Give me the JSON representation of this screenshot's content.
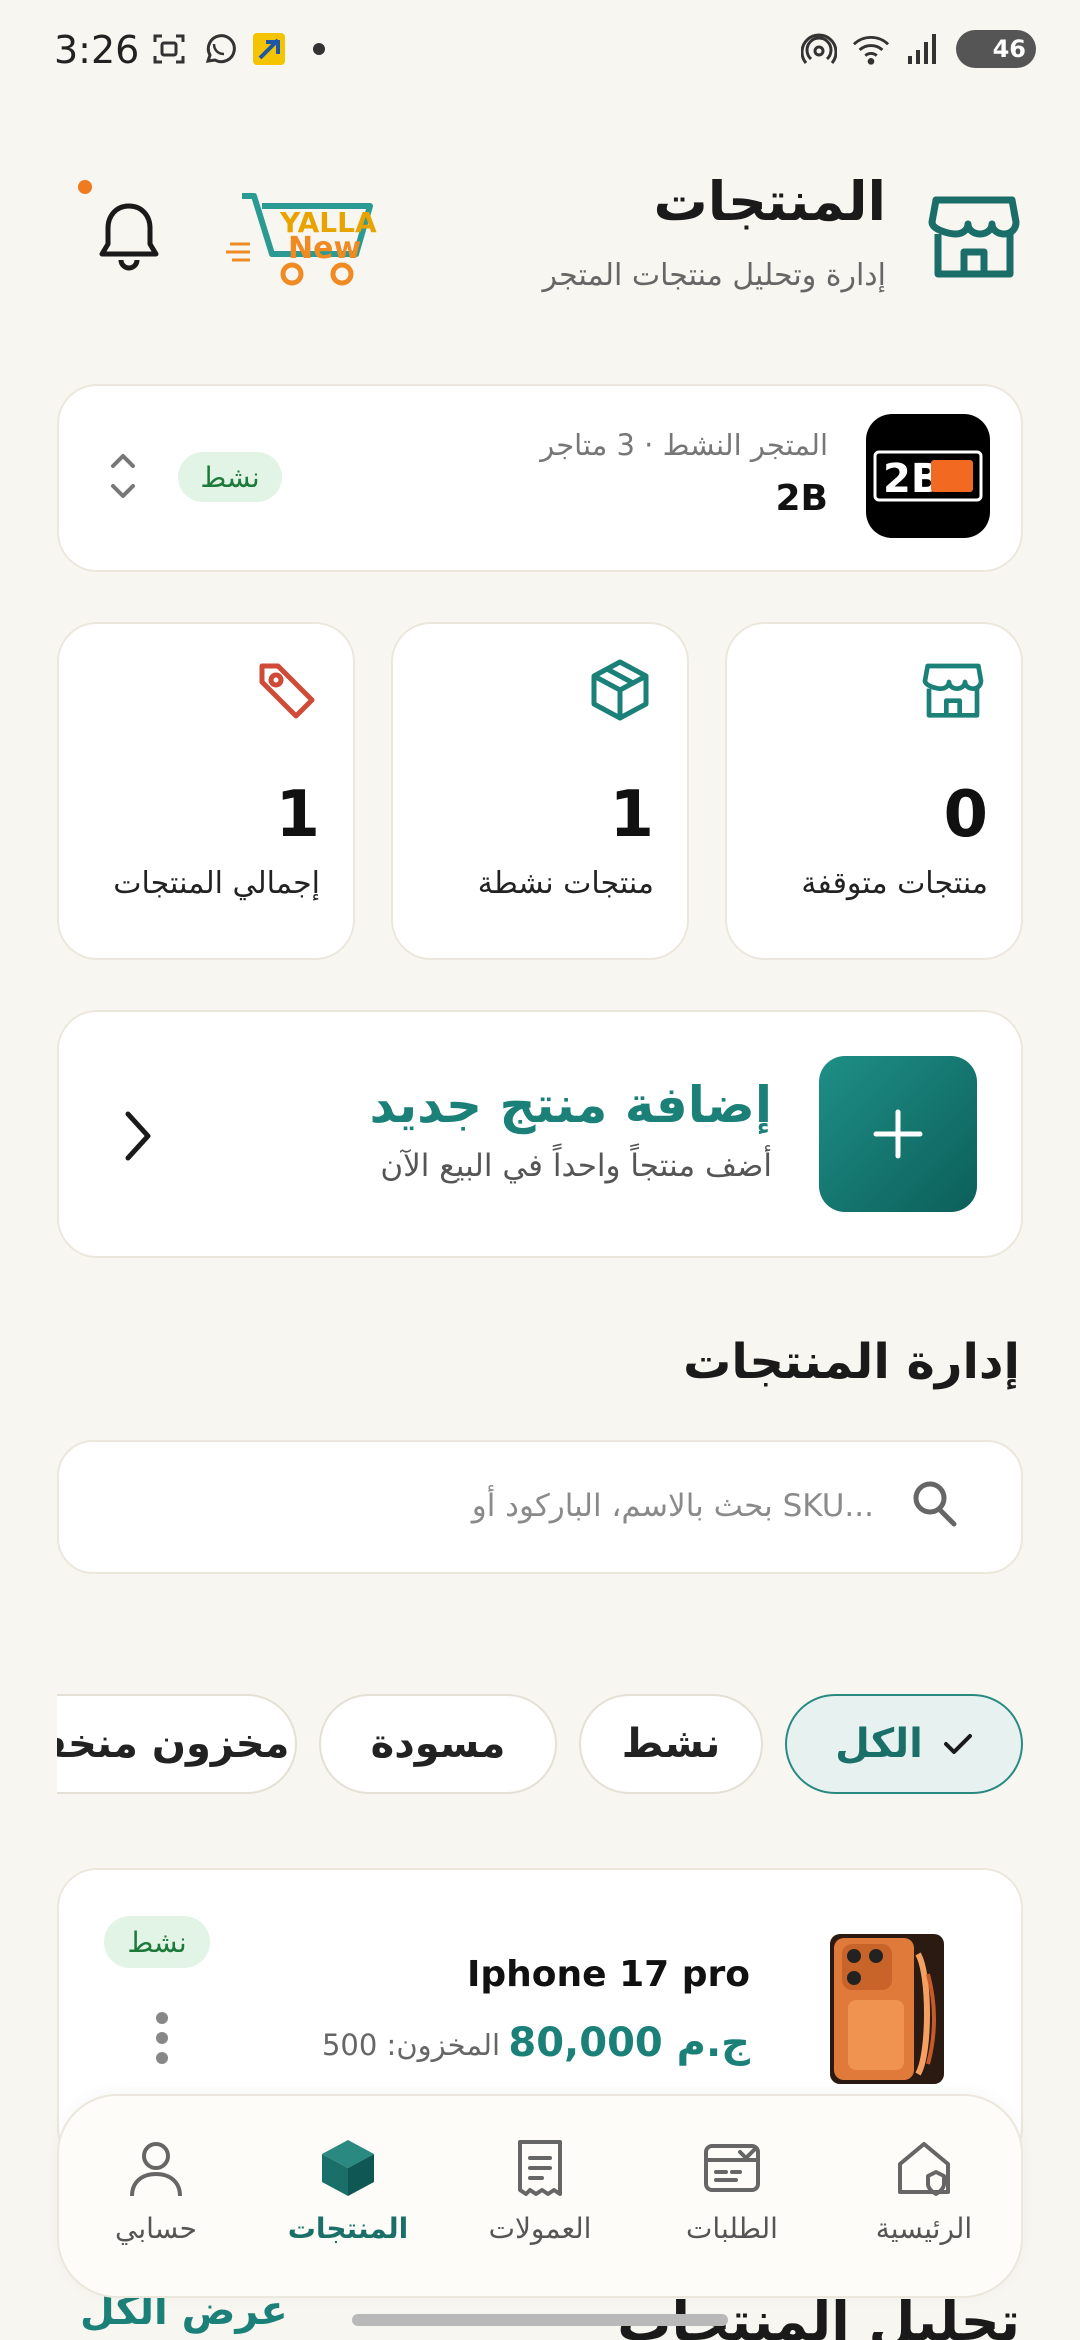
{
  "status_bar": {
    "time": "3:26",
    "battery": "46",
    "left_icons": [
      "screenshot-icon",
      "whatsapp-icon",
      "app-icon",
      "dot-icon"
    ],
    "right_icons": [
      "hotspot-icon",
      "wifi-icon",
      "signal-icon",
      "battery-icon"
    ]
  },
  "header": {
    "title": "المنتجات",
    "subtitle": "إدارة وتحليل منتجات المتجر",
    "logo_text_1": "YALLA",
    "logo_text_2": "New",
    "icons": [
      "store-icon",
      "bell-icon"
    ]
  },
  "active_store": {
    "meta": "المتجر النشط · 3 متاجر",
    "name": "2B",
    "status": "نشط",
    "logo_text": "2B"
  },
  "stats": [
    {
      "label": "منتجات متوقفة",
      "value": "0",
      "icon": "store-icon"
    },
    {
      "label": "منتجات نشطة",
      "value": "1",
      "icon": "box-icon"
    },
    {
      "label": "إجمالي المنتجات",
      "value": "1",
      "icon": "tag-icon"
    }
  ],
  "add_product": {
    "title": "إضافة منتج جديد",
    "subtitle": "أضف منتجاً واحداً في البيع الآن"
  },
  "products_section": {
    "title": "إدارة المنتجات",
    "search_placeholder": "بحث بالاسم، الباركود أو SKU..."
  },
  "filters": [
    {
      "label": "الكل",
      "active": true
    },
    {
      "label": "نشط",
      "active": false
    },
    {
      "label": "مسودة",
      "active": false
    },
    {
      "label": "مخزون منخفض",
      "active": false
    }
  ],
  "product": {
    "name": "Iphone 17 pro",
    "price": "80,000 ج.م",
    "stock": "المخزون: 500",
    "status": "نشط"
  },
  "analytics": {
    "title": "تحليل المنتجات",
    "view_all": "عرض الكل"
  },
  "bottom_nav": [
    {
      "label": "الرئيسية",
      "icon": "home-icon",
      "active": false
    },
    {
      "label": "الطلبات",
      "icon": "orders-icon",
      "active": false
    },
    {
      "label": "العمولات",
      "icon": "receipt-icon",
      "active": false
    },
    {
      "label": "المنتجات",
      "icon": "cube-icon",
      "active": true
    },
    {
      "label": "حسابي",
      "icon": "user-icon",
      "active": false
    }
  ],
  "colors": {
    "background": "#f8f6f0",
    "accent": "#1a8078",
    "active_badge": "#e1f4e6",
    "notification_dot": "#f07a1e",
    "tag_icon": "#d04a38"
  }
}
